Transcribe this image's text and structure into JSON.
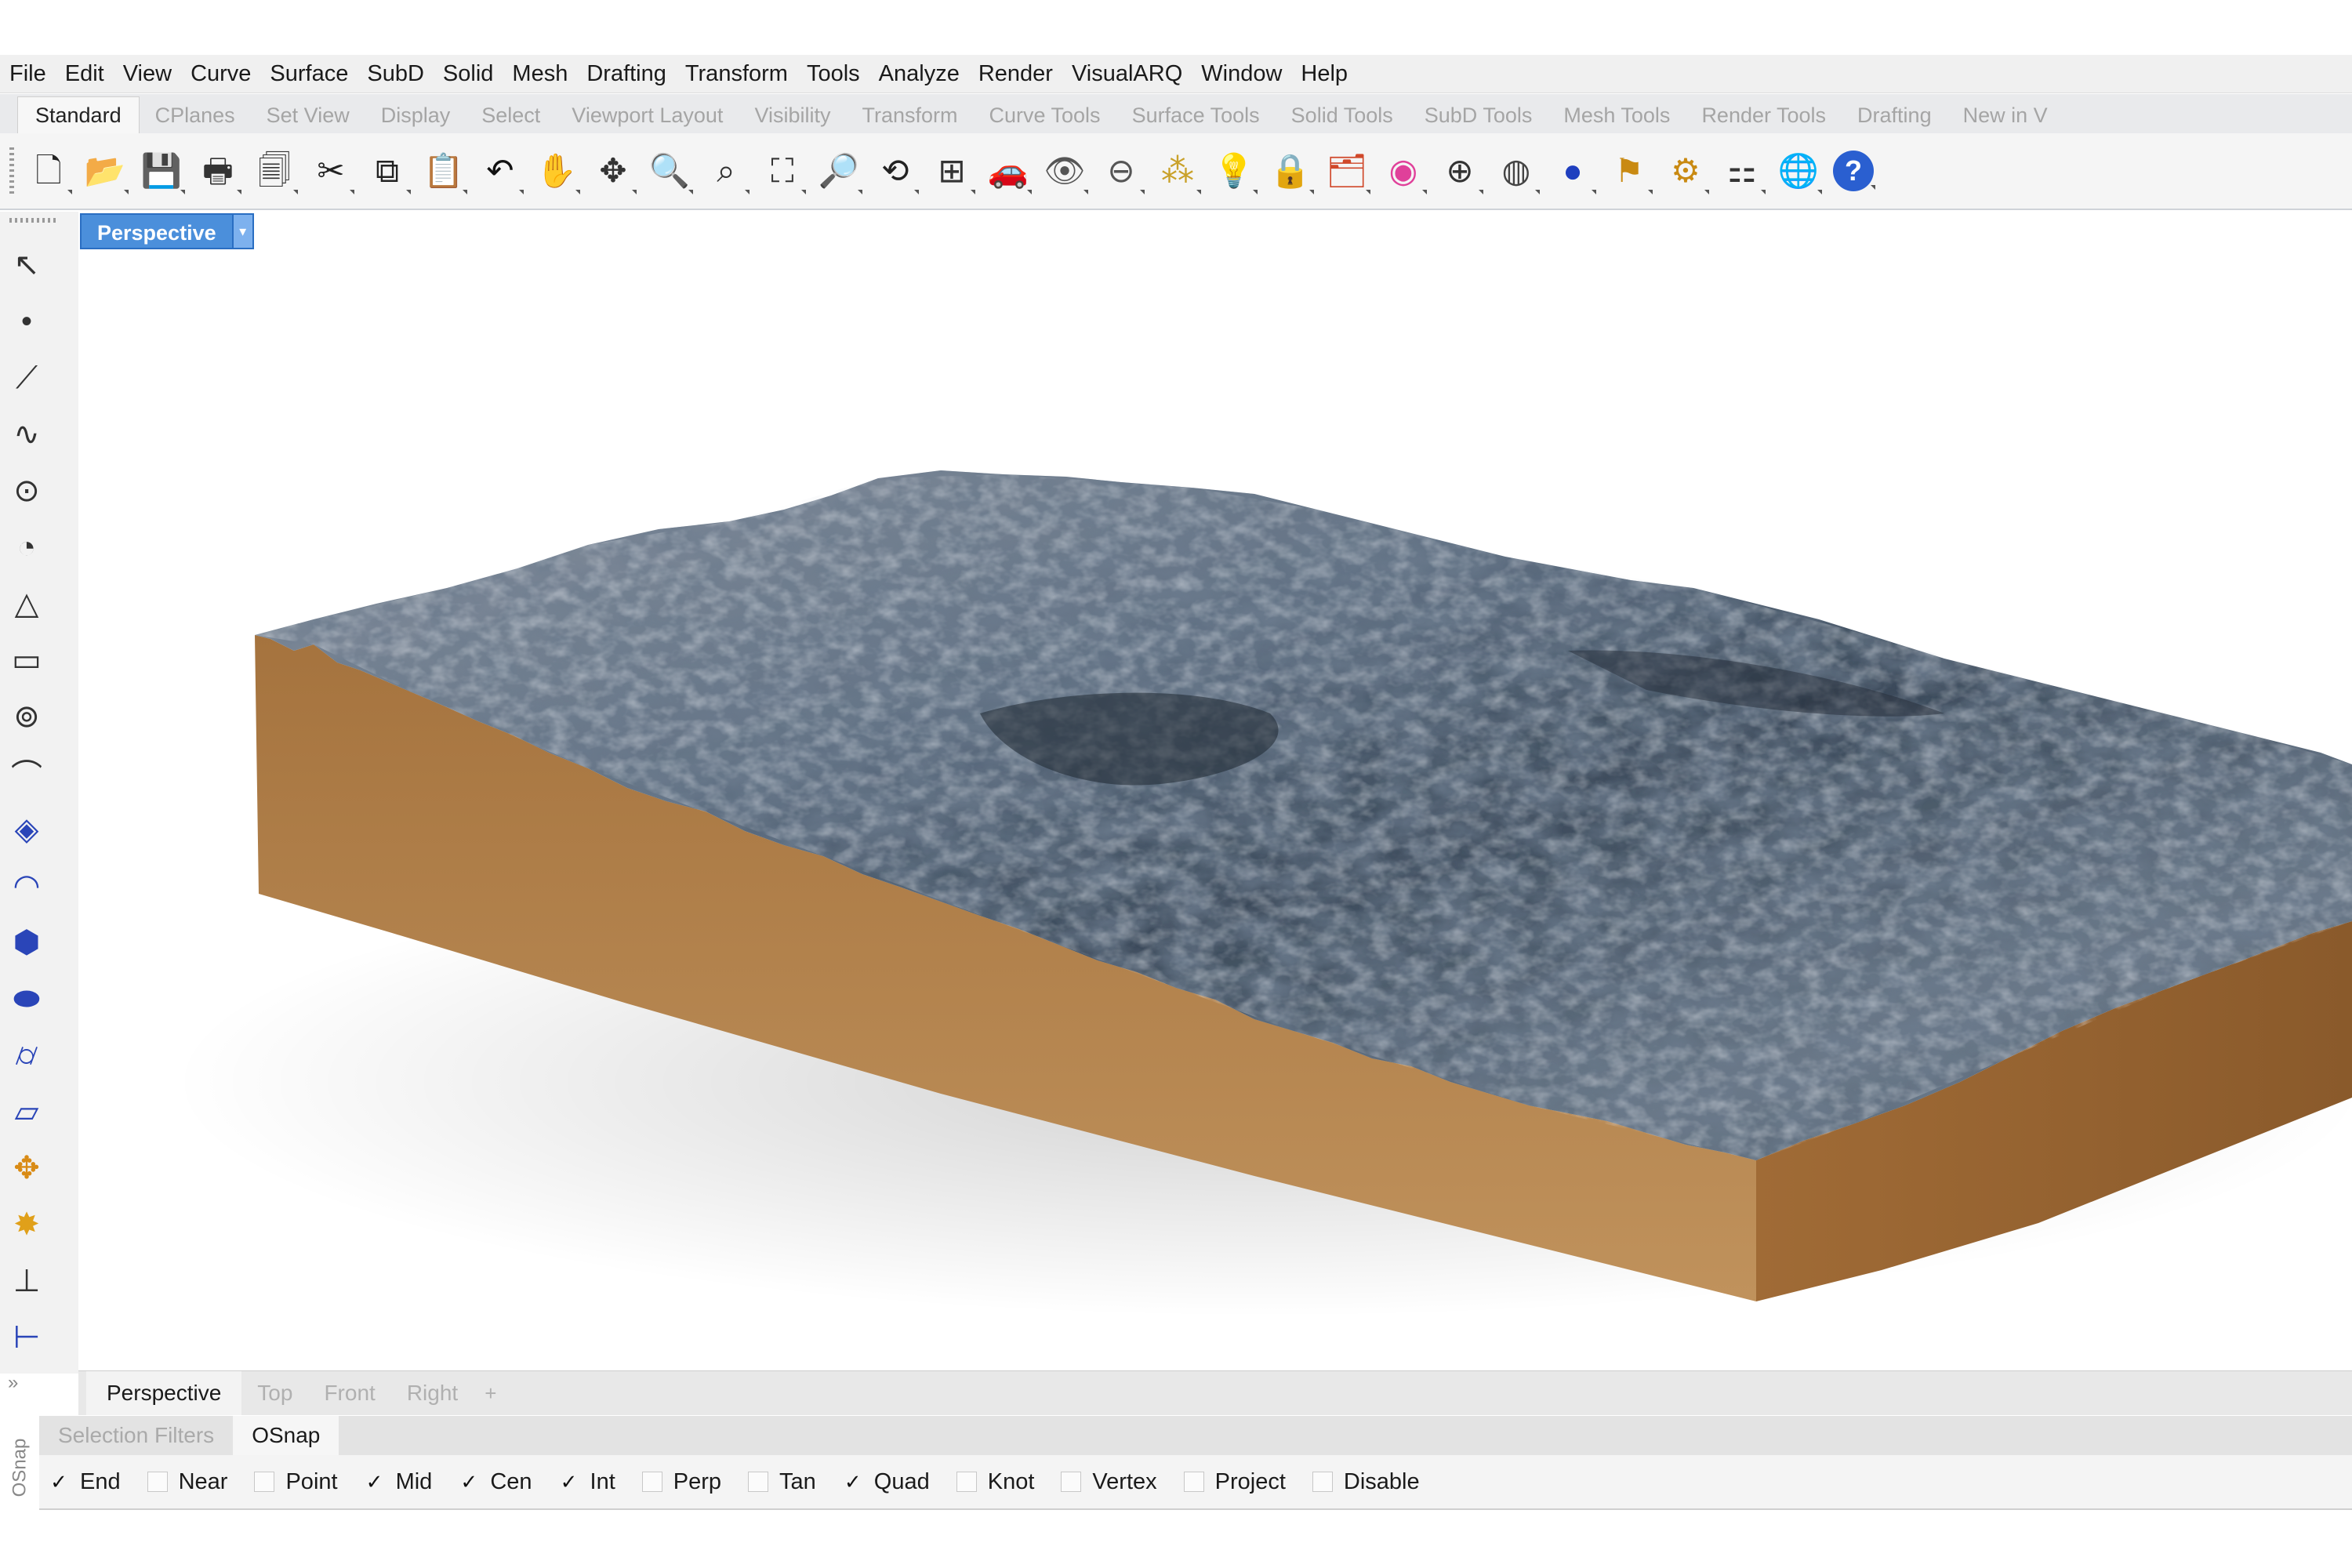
{
  "menus": [
    "File",
    "Edit",
    "View",
    "Curve",
    "Surface",
    "SubD",
    "Solid",
    "Mesh",
    "Drafting",
    "Transform",
    "Tools",
    "Analyze",
    "Render",
    "VisualARQ",
    "Window",
    "Help"
  ],
  "tabs": [
    "Standard",
    "CPlanes",
    "Set View",
    "Display",
    "Select",
    "Viewport Layout",
    "Visibility",
    "Transform",
    "Curve Tools",
    "Surface Tools",
    "Solid Tools",
    "SubD Tools",
    "Mesh Tools",
    "Render Tools",
    "Drafting",
    "New in V"
  ],
  "active_tab": "Standard",
  "toolbar_icons": [
    {
      "name": "new-file-icon",
      "glyph": "🗋",
      "color": "#222"
    },
    {
      "name": "open-folder-icon",
      "glyph": "📂",
      "color": "#d99a1c"
    },
    {
      "name": "save-icon",
      "glyph": "💾",
      "color": "#333"
    },
    {
      "name": "print-icon",
      "glyph": "🖶",
      "color": "#333"
    },
    {
      "name": "import-icon",
      "glyph": "🗐",
      "color": "#333"
    },
    {
      "name": "cut-icon",
      "glyph": "✂",
      "color": "#222"
    },
    {
      "name": "copy-icon",
      "glyph": "⧉",
      "color": "#222"
    },
    {
      "name": "paste-icon",
      "glyph": "📋",
      "color": "#d9a520"
    },
    {
      "name": "undo-icon",
      "glyph": "↶",
      "color": "#111"
    },
    {
      "name": "pan-hand-icon",
      "glyph": "✋",
      "color": "#333"
    },
    {
      "name": "move-cross-icon",
      "glyph": "✥",
      "color": "#333"
    },
    {
      "name": "zoom-icon",
      "glyph": "🔍",
      "color": "#333"
    },
    {
      "name": "zoom-window-icon",
      "glyph": "⌕",
      "color": "#333"
    },
    {
      "name": "zoom-extents-icon",
      "glyph": "⛶",
      "color": "#333"
    },
    {
      "name": "zoom-selected-icon",
      "glyph": "🔎",
      "color": "#b99a10"
    },
    {
      "name": "rotate-view-icon",
      "glyph": "⟲",
      "color": "#222"
    },
    {
      "name": "four-viewports-icon",
      "glyph": "⊞",
      "color": "#333"
    },
    {
      "name": "car-icon",
      "glyph": "🚗",
      "color": "#c62828"
    },
    {
      "name": "eye-icon",
      "glyph": "👁",
      "color": "#555"
    },
    {
      "name": "camera-target-icon",
      "glyph": "⊖",
      "color": "#555"
    },
    {
      "name": "select-points-icon",
      "glyph": "⁂",
      "color": "#c9a12a"
    },
    {
      "name": "light-bulb-icon",
      "glyph": "💡",
      "color": "#666"
    },
    {
      "name": "lock-icon",
      "glyph": "🔒",
      "color": "#444"
    },
    {
      "name": "layer-icon",
      "glyph": "🗂",
      "color": "#d0482a"
    },
    {
      "name": "color-wheel-icon",
      "glyph": "◉",
      "color": "#e0409a"
    },
    {
      "name": "wireframe-sphere-icon",
      "glyph": "⊕",
      "color": "#333"
    },
    {
      "name": "shaded-sphere-icon",
      "glyph": "◍",
      "color": "#444"
    },
    {
      "name": "render-sphere-icon",
      "glyph": "●",
      "color": "#1f3fbf"
    },
    {
      "name": "flag-icon",
      "glyph": "⚑",
      "color": "#c98a12"
    },
    {
      "name": "gear-icon",
      "glyph": "⚙",
      "color": "#c98a12"
    },
    {
      "name": "hierarchy-icon",
      "glyph": "⚏",
      "color": "#333"
    },
    {
      "name": "globe-icon",
      "glyph": "🌐",
      "color": "#2e8b3a"
    },
    {
      "name": "help-icon",
      "glyph": "?",
      "color": "#2a5fd0"
    }
  ],
  "left_tools": [
    {
      "name": "select-arrow-icon",
      "glyph": "↖",
      "color": "#333"
    },
    {
      "name": "point-icon",
      "glyph": "•",
      "color": "#333"
    },
    {
      "name": "polyline-icon",
      "glyph": "⟋",
      "color": "#333"
    },
    {
      "name": "curve-icon",
      "glyph": "∿",
      "color": "#333"
    },
    {
      "name": "circle-icon",
      "glyph": "⊙",
      "color": "#333"
    },
    {
      "name": "arc-icon",
      "glyph": "◔",
      "color": "#333"
    },
    {
      "name": "triangle-icon",
      "glyph": "△",
      "color": "#333"
    },
    {
      "name": "rectangle-icon",
      "glyph": "▭",
      "color": "#333"
    },
    {
      "name": "ellipse-icon",
      "glyph": "⊚",
      "color": "#333"
    },
    {
      "name": "fillet-icon",
      "glyph": "⌒",
      "color": "#333"
    },
    {
      "name": "surface-icon",
      "glyph": "◈",
      "color": "#2a45b8"
    },
    {
      "name": "revolve-icon",
      "glyph": "◠",
      "color": "#2a45b8"
    },
    {
      "name": "box-icon",
      "glyph": "⬢",
      "color": "#2a45b8"
    },
    {
      "name": "boolean-icon",
      "glyph": "⬬",
      "color": "#2a45b8"
    },
    {
      "name": "cylinder-icon",
      "glyph": "⌭",
      "color": "#2a45b8"
    },
    {
      "name": "plane-icon",
      "glyph": "▱",
      "color": "#2a45b8"
    },
    {
      "name": "transform-icon",
      "glyph": "✥",
      "color": "#d98b15"
    },
    {
      "name": "explode-icon",
      "glyph": "✸",
      "color": "#e0a01a"
    },
    {
      "name": "dimension-icon",
      "glyph": "⊥",
      "color": "#333"
    },
    {
      "name": "annotate-icon",
      "glyph": "⊢",
      "color": "#2a45b8"
    }
  ],
  "viewport": {
    "label": "Perspective",
    "dropdown": "▾"
  },
  "viewport_tabs": [
    "Perspective",
    "Top",
    "Front",
    "Right"
  ],
  "viewport_tab_add": "+",
  "panel_tabs": [
    "Selection Filters",
    "OSnap"
  ],
  "active_panel_tab": "OSnap",
  "side_label": "OSnap",
  "left_more": "»",
  "osnaps": [
    {
      "label": "End",
      "checked": true
    },
    {
      "label": "Near",
      "checked": false
    },
    {
      "label": "Point",
      "checked": false
    },
    {
      "label": "Mid",
      "checked": true
    },
    {
      "label": "Cen",
      "checked": true
    },
    {
      "label": "Int",
      "checked": true
    },
    {
      "label": "Perp",
      "checked": false
    },
    {
      "label": "Tan",
      "checked": false
    },
    {
      "label": "Quad",
      "checked": true
    },
    {
      "label": "Knot",
      "checked": false
    },
    {
      "label": "Vertex",
      "checked": false
    },
    {
      "label": "Project",
      "checked": false
    },
    {
      "label": "Disable",
      "checked": false
    }
  ],
  "colors": {
    "accent": "#3e86d8",
    "terrain_side": "#b07d47",
    "terrain_top": "#5d6b78"
  }
}
